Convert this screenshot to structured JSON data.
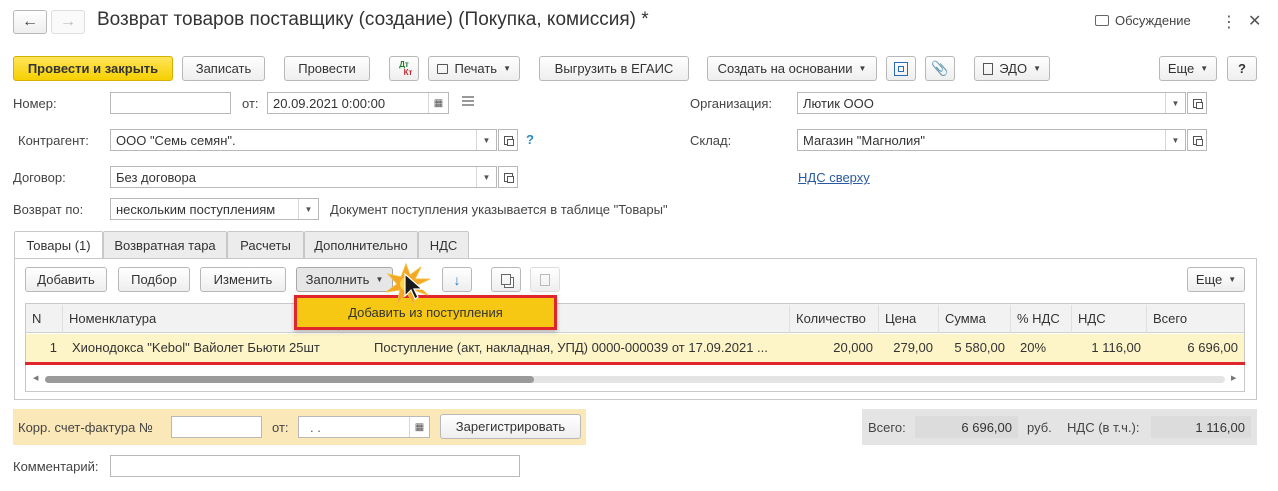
{
  "window": {
    "title": "Возврат товаров поставщику (создание) (Покупка, комиссия) *",
    "discussion_label": "Обсуждение"
  },
  "toolbar": {
    "post_close": "Провести и закрыть",
    "save": "Записать",
    "post": "Провести",
    "dtkt_top": "Дт",
    "dtkt_bottom": "Кт",
    "print": "Печать",
    "egais": "Выгрузить в ЕГАИС",
    "create_based": "Создать на основании",
    "edo": "ЭДО",
    "more": "Еще",
    "help": "?"
  },
  "form": {
    "number_label": "Номер:",
    "number_value": "",
    "date_label": "от:",
    "date_value": "20.09.2021  0:00:00",
    "org_label": "Организация:",
    "org_value": "Лютик ООО",
    "contractor_label": "Контрагент:",
    "contractor_value": "ООО \"Семь семян\".",
    "warehouse_label": "Склад:",
    "warehouse_value": "Магазин \"Магнолия\"",
    "contract_label": "Договор:",
    "contract_value": "Без договора",
    "vat_link": "НДС сверху",
    "return_by_label": "Возврат по:",
    "return_by_value": "нескольким поступлениям",
    "return_by_hint": "Документ поступления указывается в таблице \"Товары\"",
    "help_mark": "?"
  },
  "tabs": [
    {
      "label": "Товары (1)",
      "active": true
    },
    {
      "label": "Возвратная тара",
      "active": false
    },
    {
      "label": "Расчеты",
      "active": false
    },
    {
      "label": "Дополнительно",
      "active": false
    },
    {
      "label": "НДС",
      "active": false
    }
  ],
  "table_toolbar": {
    "add": "Добавить",
    "pick": "Подбор",
    "edit": "Изменить",
    "fill": "Заполнить",
    "more": "Еще",
    "fill_menu_item": "Добавить из поступления"
  },
  "table": {
    "columns": [
      "N",
      "Номенклатура",
      "",
      "Количество",
      "Цена",
      "Сумма",
      "% НДС",
      "НДС",
      "Всего"
    ],
    "rows": [
      {
        "n": "1",
        "item": "Хионодокса \"Kebol\" Вайолет Бьюти 25шт",
        "receipt": "Поступление (акт, накладная, УПД) 0000-000039 от 17.09.2021 ...",
        "qty": "20,000",
        "price": "279,00",
        "sum": "5 580,00",
        "vat_rate": "20%",
        "vat": "1 116,00",
        "total": "6 696,00"
      }
    ]
  },
  "footer": {
    "corr_invoice_label": "Корр. счет-фактура №",
    "corr_invoice_value": "",
    "corr_date_label": "от:",
    "corr_date_value": " .  .",
    "register_button": "Зарегистрировать",
    "total_label": "Всего:",
    "total_value": "6 696,00",
    "currency": "руб.",
    "vat_incl_label": "НДС (в т.ч.):",
    "vat_incl_value": "1 116,00",
    "comment_label": "Комментарий:",
    "comment_value": ""
  },
  "colors": {
    "accent_yellow": "#f6d000",
    "highlight_row": "#fdf4c8",
    "red_annotation": "#e0262d",
    "link": "#2a5aa0"
  }
}
